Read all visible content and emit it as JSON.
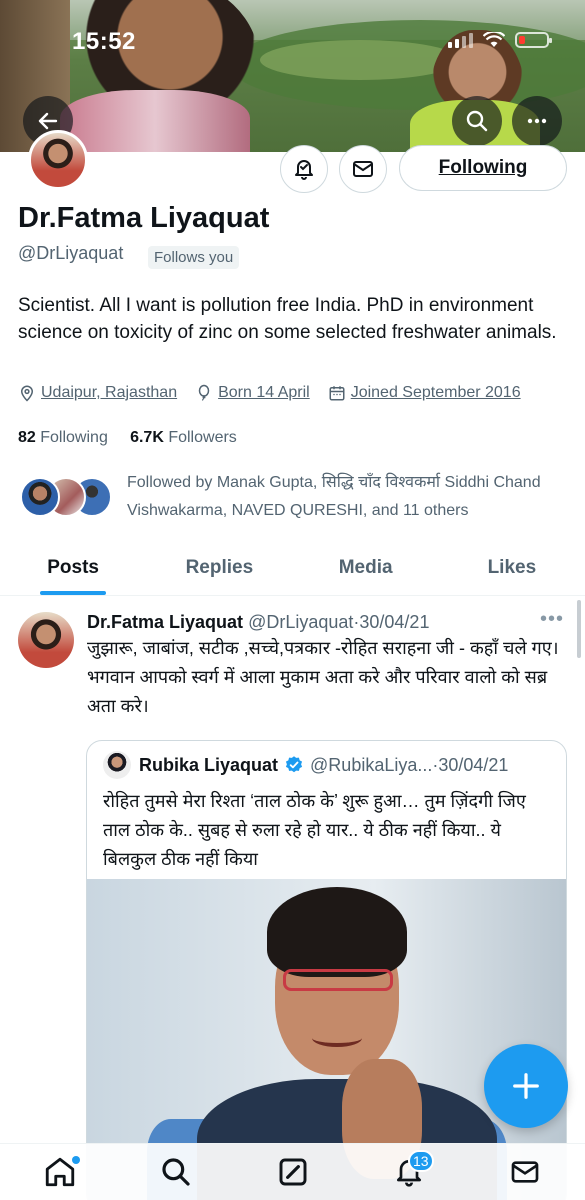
{
  "status_bar": {
    "time": "15:52"
  },
  "profile": {
    "name": "Dr.Fatma Liyaquat",
    "handle": "@DrLiyaquat",
    "follows_you": "Follows you",
    "follow_button": "Following",
    "bio": "Scientist. All I want is pollution free India. PhD in environment science on toxicity of zinc on some selected freshwater animals.",
    "location": "Udaipur, Rajasthan",
    "birthday": "Born 14 April",
    "joined": "Joined September 2016",
    "following_count": "82",
    "following_label": "Following",
    "followers_count": "6.7K",
    "followers_label": "Followers",
    "followed_by": "Followed by Manak Gupta, सिद्धि चाँद विश्वकर्मा Siddhi Chand Vishwakarma, NAVED QURESHI, and 11 others"
  },
  "tabs": [
    {
      "label": "Posts",
      "active": true
    },
    {
      "label": "Replies"
    },
    {
      "label": "Media"
    },
    {
      "label": "Likes"
    }
  ],
  "tweet": {
    "name": "Dr.Fatma Liyaquat",
    "handle": "@DrLiyaquat",
    "date": "30/04/21",
    "text": "जुझारू, जाबांज, सटीक ,सच्चे,पत्रकार -रोहित सराहना जी - कहाँ चले गए। भगवान आपको स्वर्ग में आला मुकाम अता करे और परिवार वालो को सब्र अता करे।",
    "quote": {
      "name": "Rubika Liyaquat",
      "handle": "@RubikaLiya...",
      "date": "30/04/21",
      "text": "रोहित तुमसे मेरा रिश्ता ‘ताल ठोक के’ शुरू हुआ… तुम ज़िंदगी जिए ताल ठोक के.. सुबह से रुला रहे हो यार.. ये ठीक नहीं किया.. ये बिलकुल ठीक नहीं किया"
    }
  },
  "bottom_nav": {
    "notifications_badge": "13"
  },
  "colors": {
    "accent": "#1d9bf0",
    "text": "#0f1419",
    "muted": "#536471"
  },
  "icons": [
    "back-arrow-icon",
    "search-icon",
    "more-icon",
    "notification-bell-icon",
    "mail-icon",
    "location-icon",
    "balloon-icon",
    "calendar-icon",
    "verified-icon",
    "plus-icon",
    "home-icon",
    "compose-icon"
  ]
}
